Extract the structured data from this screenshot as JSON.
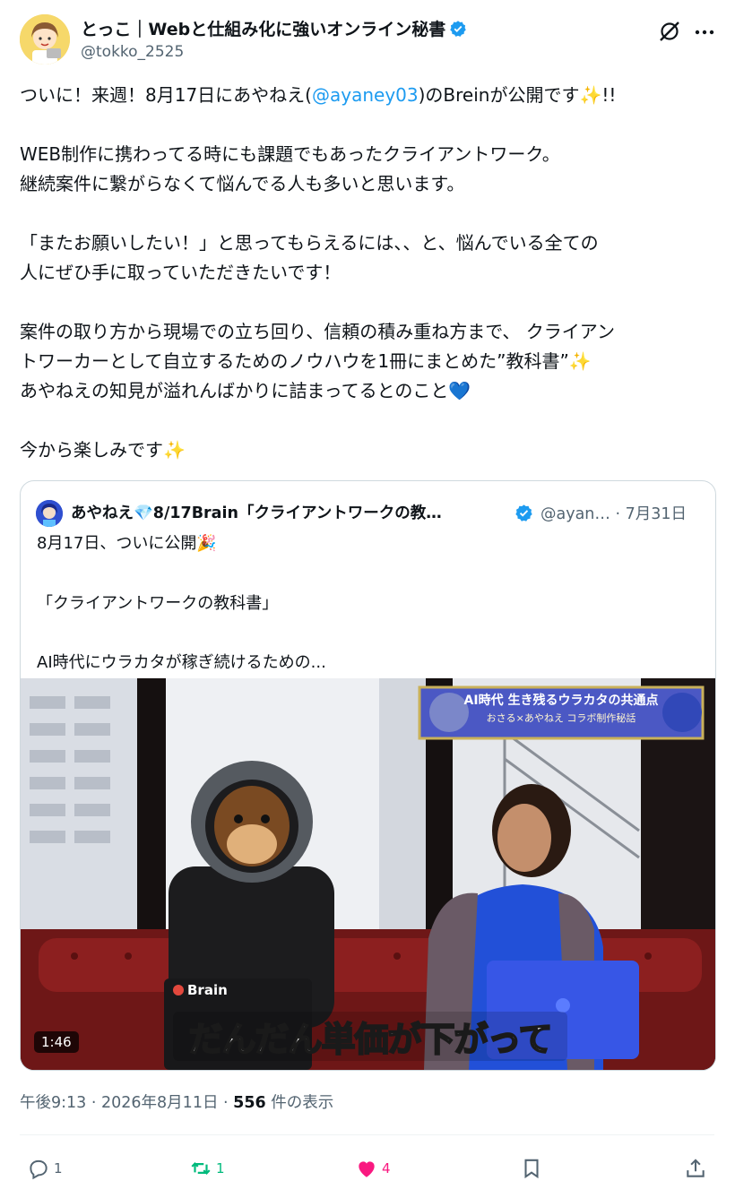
{
  "author": {
    "display_name": "とっこ｜Webと仕組み化に強いオンライン秘書",
    "handle": "@tokko_2525",
    "verified": true,
    "avatar_icon": "avatar-illustration-icon"
  },
  "header_icons": {
    "grok": "grok-slash-icon",
    "more": "more-dots-icon"
  },
  "tweet": {
    "line1_before": "ついに！来週！8月17日にあやねえ(",
    "line1_mention": "@ayaney03",
    "line1_after": ")のBreinが公開です",
    "line1_end": "!!",
    "line1_emoji": "✨",
    "para2_line1": "WEB制作に携わってる時にも課題でもあったクライアントワーク。",
    "para2_line2": "継続案件に繋がらなくて悩んでる人も多いと思います。",
    "para3_line1": "「またお願いしたい！」と思ってもらえるには、、と、悩んでいる全ての",
    "para3_line2": "人にぜひ手に取っていただきたいです！",
    "para4_line1": "案件の取り方から現場での立ち回り、信頼の積み重ね方まで、 クライアン",
    "para4_line2": "トワーカーとして自立するためのノウハウを1冊にまとめた”教科書”",
    "para4_line2_emoji": "✨",
    "para4_line3": "あやねえの知見が溢れんばかりに詰まってるとのこと",
    "para4_line3_emoji": "💙",
    "para5": "今から楽しみです",
    "para5_emoji": "✨"
  },
  "quote": {
    "display_name": "あやねえ💎8/17Brain「クライアントワークの教…",
    "handle": "@ayan…",
    "date": "· 7月31日",
    "line1": "8月17日、ついに公開🎉",
    "line2": "「クライアントワークの教科書」",
    "line3": "AI時代にウラカタが稼ぎ続けるための...",
    "video": {
      "banner_title": "AI時代 生き残るウラカタの共通点",
      "banner_sub": "おさる×あやねえ コラボ制作秘話",
      "laptop_label": "Brain",
      "caption": "だんだん単価が下がって",
      "duration": "1:46"
    }
  },
  "meta": {
    "time": "午後9:13",
    "sep1": " · ",
    "date": "2026年8月11日",
    "sep2": " · ",
    "views": "556",
    "views_label": " 件の表示"
  },
  "actions": {
    "reply_count": "1",
    "retweet_count": "1",
    "like_count": "4"
  },
  "colors": {
    "accent": "#1d9bf0",
    "retweet": "#00ba7c",
    "like": "#f91880",
    "secondary_text": "#536471"
  }
}
